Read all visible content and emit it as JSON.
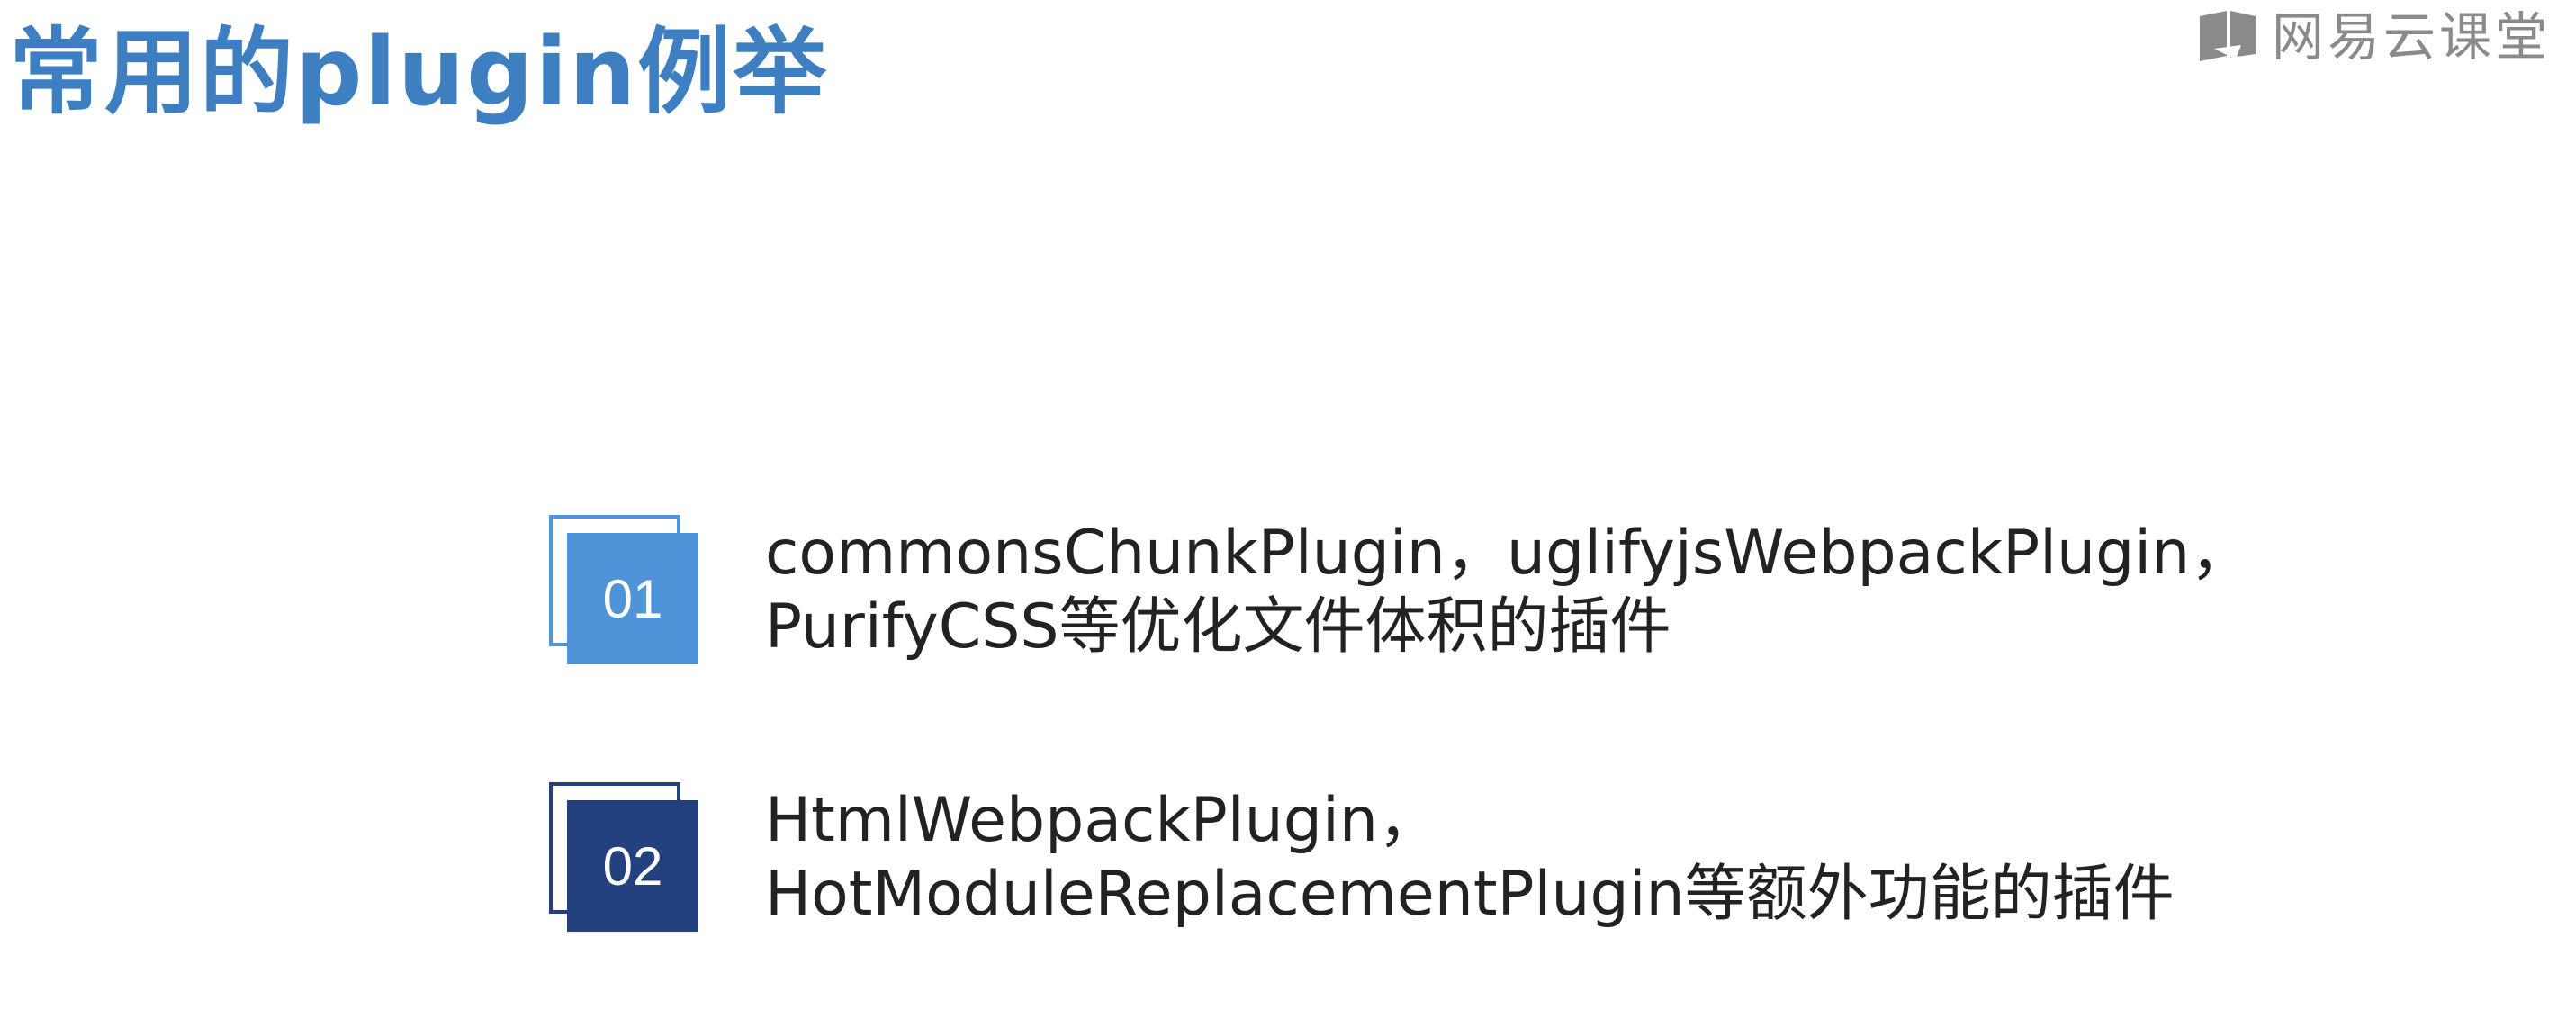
{
  "slide": {
    "title": "常用的plugin例举"
  },
  "brand": {
    "icon": "book-icon",
    "name": "网易云课堂",
    "color": "#8a8a8a"
  },
  "colors": {
    "title": "#3d7fc1",
    "badge_1": "#4f94d8",
    "badge_2": "#23417f",
    "text": "#222222"
  },
  "items": [
    {
      "number": "01",
      "line1": "commonsChunkPlugin，uglifyjsWebpackPlugin，",
      "line2": "PurifyCSS等优化文件体积的插件"
    },
    {
      "number": "02",
      "line1": "HtmlWebpackPlugin，",
      "line2": "HotModuleReplacementPlugin等额外功能的插件"
    }
  ]
}
